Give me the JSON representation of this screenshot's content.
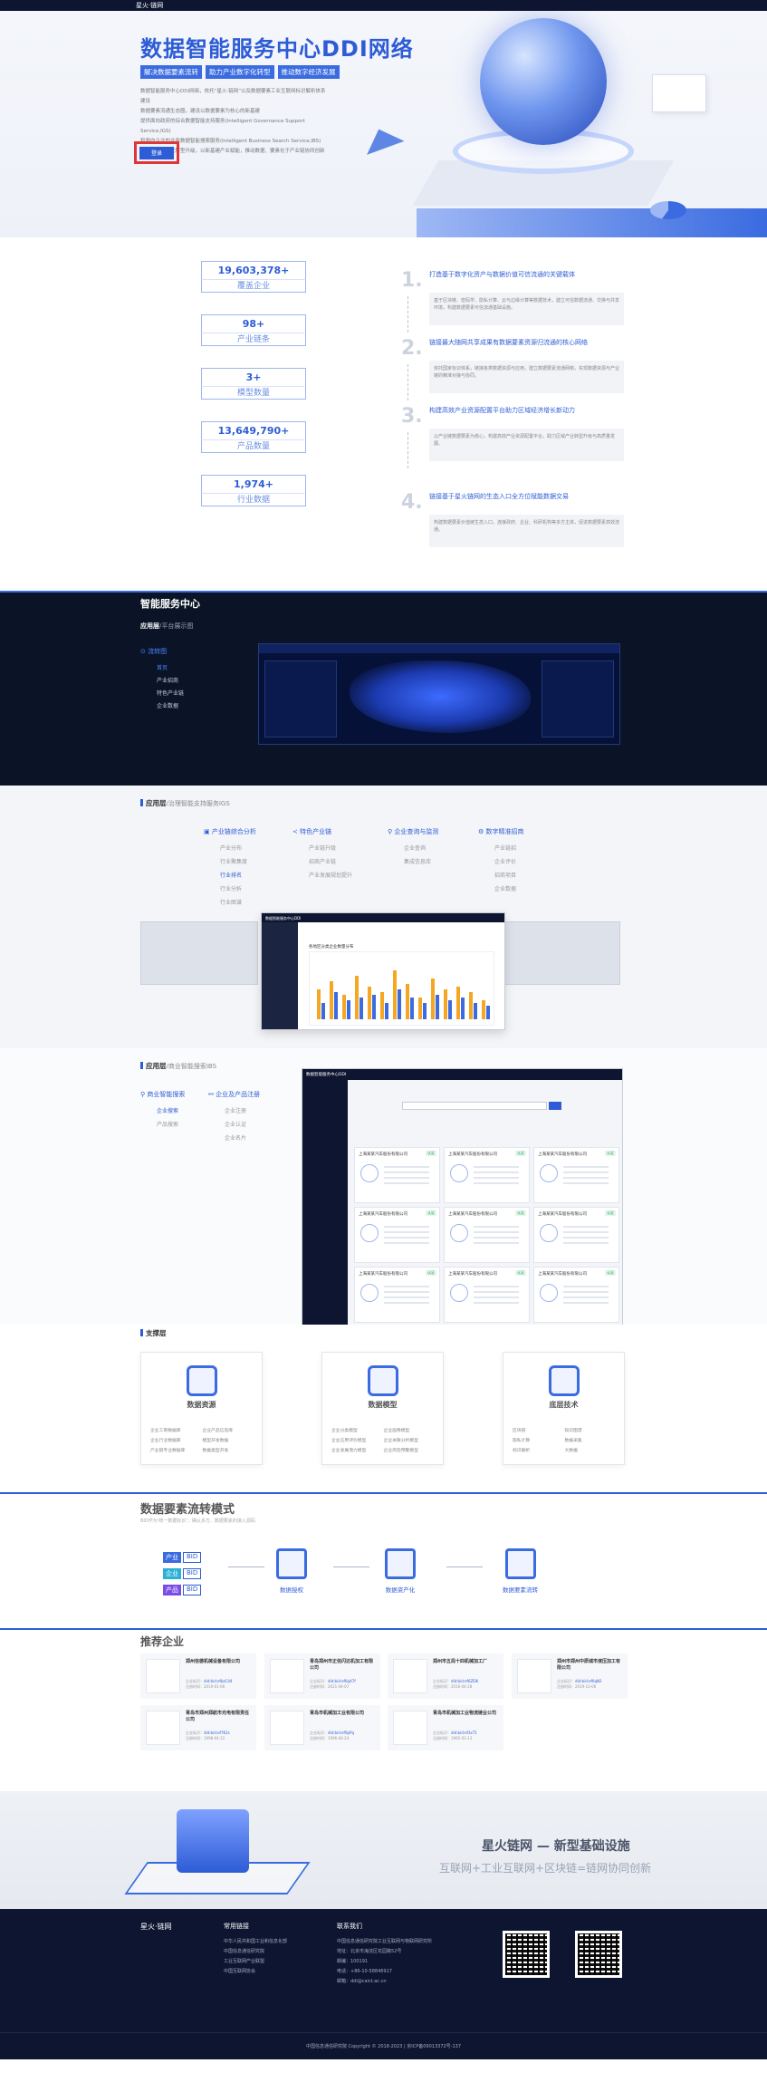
{
  "topbar": {
    "logo": "星火·链网"
  },
  "hero": {
    "title": "数据智能服务中心DDI网络",
    "tags": [
      "解决数据要素流转 助力产业数字化转型 推动数字经济发展"
    ],
    "tag_parts": [
      "解决数据要素流转",
      "助力产业数字化转型",
      "推动数字经济发展"
    ],
    "desc": [
      "数据智能服务中心DDI网络，依托“星火·链网”以及数据要素工业互联网标识解析体系建设",
      "数据要素流通生态圈，建设以数据要素为核心的新基建",
      "提供面向政府的综合数据智能支持服务(Intelligent Governance Support Service,IGS)",
      "和面向企业的业务数据智能搜索服务(Intelligent Business Search Service,IBS)",
      "助力产业数字化转型升级，以新基建产业赋能，推动数据、要素化于产业链协同创新"
    ],
    "button": "登录"
  },
  "stats": [
    {
      "value": "19,603,378+",
      "label": "覆盖企业"
    },
    {
      "value": "98+",
      "label": "产业链条"
    },
    {
      "value": "3+",
      "label": "模型数量"
    },
    {
      "value": "13,649,790+",
      "label": "产品数量"
    },
    {
      "value": "1,974+",
      "label": "行业数据"
    }
  ],
  "steps": [
    {
      "num": "1.",
      "title": "打造基于数字化资产与数据价值可信流通的关键载体",
      "body": "基于区块链、密码学、隐私计算、云与边缘计算等数据技术，建立可信数据流通、交换与共享环境，构建数据要素可信流通基础设施。"
    },
    {
      "num": "2.",
      "title": "链接最大随网共享成果有数据要素资源归流通的核心网络",
      "body": "依托国家标识体系，链接各类数据资源与应用，建立数据要素流通网络，实现数据资源与产业链的精准对接与协同。"
    },
    {
      "num": "3.",
      "title": "构建高效产业资源配置平台助力区域经济增长新动力",
      "body": "以产业链数据要素为核心，构建高效产业资源配置平台，助力区域产业转型升级与高质量发展。"
    },
    {
      "num": "4.",
      "title": "链接基于星火链网的生态入口全方位赋能数据交易",
      "body": "构建数据要素价值链生态入口，连接政府、企业、科研机构等多方主体，促进数据要素高效流通。"
    }
  ],
  "smart": {
    "title": "智能服务中心",
    "layer_bold": "应用层",
    "layer_rest": "/平台展示图",
    "nav_head": "⊙ 流转图",
    "nav_items": [
      "首页",
      "产业招商",
      "特色产业链",
      "企业数据"
    ]
  },
  "app1": {
    "layer_bold": "应用层",
    "layer_rest": "/治理智能支持服务IGS",
    "cols": [
      {
        "head": "▣ 产业链综合分析",
        "items": [
          "产业分布",
          "行业聚集度",
          "行业排名",
          "行业分析",
          "行业图谱"
        ]
      },
      {
        "head": "≺ 特色产业链",
        "items": [
          "产业链升级",
          "招商产业链",
          "产业发展规划提升"
        ]
      },
      {
        "head": "⚲ 企业查询与监测",
        "items": [
          "企业查询",
          "集成信息库"
        ]
      },
      {
        "head": "⚙ 数字精准招商",
        "items": [
          "产业链招",
          "企业评价",
          "招商项目",
          "企业数据"
        ]
      }
    ],
    "shot_title": "数据智能服务中心DDI",
    "chart_title": "各地区分类企业数量分布"
  },
  "app2": {
    "layer_bold": "应用层",
    "layer_rest": "/商业智能搜索IBS",
    "cols": [
      {
        "head": "⚲ 商业智能搜索",
        "items": [
          "企业搜索",
          "产品搜索"
        ]
      },
      {
        "head": "⚯ 企业及产品注册",
        "items": [
          "企业注册",
          "企业认证",
          "企业名片"
        ]
      }
    ],
    "shot_title": "数据智能服务中心DDI",
    "card_name": "上海某某汽车股份有限公司",
    "card_tag": "认证"
  },
  "support": {
    "layer_bold": "支撑层",
    "cards": [
      {
        "title": "数据资源",
        "items": [
          "企业工商数据库",
          "企业产品信息库",
          "企业行业数据库",
          "模型开发数据",
          "产业链专业数据库",
          "数据类型开发"
        ]
      },
      {
        "title": "数据模型",
        "items": [
          "企业分类模型",
          "企业画像模型",
          "企业信用评价模型",
          "企业关联分析模型",
          "企业发展潜力模型",
          "企业风险预警模型"
        ]
      },
      {
        "title": "底层技术",
        "items": [
          "区块链",
          "知识图谱",
          "隐私计算",
          "数据采集",
          "标识解析",
          "大数据"
        ]
      }
    ]
  },
  "flow": {
    "title": "数据要素流转模式",
    "subtitle": "BID作为‘统一数据标识’，确认多方、数据要素的接入源码",
    "chips": [
      {
        "a": "产业",
        "b": "BID",
        "color": "#3a6be0"
      },
      {
        "a": "企业",
        "b": "BID",
        "color": "#2bb0d8"
      },
      {
        "a": "产品",
        "b": "BID",
        "color": "#7a4de6"
      }
    ],
    "nodes": [
      "数据授权",
      "数据资产化",
      "数据要素流转"
    ]
  },
  "rec": {
    "title": "推荐企业",
    "label_id": "企业标识：",
    "label_date": "注册时间：",
    "companies": [
      {
        "name": "郑州信德机械设备有限公司",
        "id": "did:bid:efbzC44",
        "date": "2019-01-06"
      },
      {
        "name": "青岛郑州市正信闪达机加工有限公司",
        "id": "did:bid:ef6qX7f",
        "date": "2021-04-07"
      },
      {
        "name": "郑州市五局十四机械加工厂",
        "id": "did:bid:ef6ZE9i",
        "date": "2016-04-28"
      },
      {
        "name": "郑州市郑州中原城市液压加工有限公司",
        "id": "did:bid:ef6qN2",
        "date": "2019-12-06"
      },
      {
        "name": "青岛市郑州郑航市光电有限责任公司",
        "id": "did:bid:ef7K2s",
        "date": "1998-04-22"
      },
      {
        "name": "青岛市机械加工业有限公司",
        "id": "did:bid:ef9pPq",
        "date": "1996-06-24"
      },
      {
        "name": "青岛市机械加工业物流链业公司",
        "id": "did:bid:ef3xT1",
        "date": "1992-03-13"
      }
    ]
  },
  "banner": {
    "headline": "星火链网 — 新型基础设施",
    "sub": "互联网+工业互联网+区块链=链网协同创新"
  },
  "footer": {
    "logo": "星火·链网",
    "links_head": "常用链接",
    "links": [
      "中华人民共和国工业和信息化部",
      "中国信息通信研究院",
      "工业互联网产业联盟",
      "中国互联网协会"
    ],
    "contact_head": "联系我们",
    "contact": [
      "中国信息通信研究院工业互联网与物联网研究所",
      "地址：北京市海淀区花园路52号",
      "邮编：100191",
      "电话：+86-10-58846917",
      "邮箱：ddi@caict.ac.cn"
    ],
    "copyright": "中国信息通信研究院 Copyright © 2018-2023 | 京ICP备09013372号-137"
  }
}
